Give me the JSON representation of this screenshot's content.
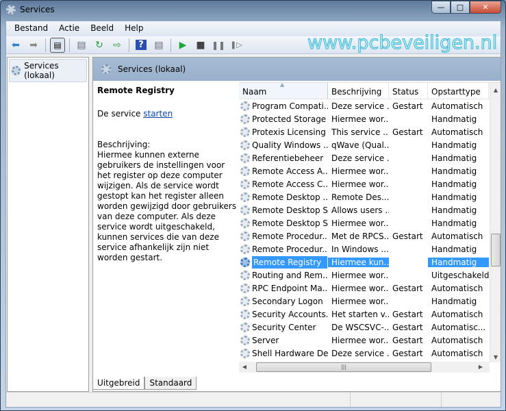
{
  "window": {
    "title": "Services",
    "controls": [
      "minimize",
      "maximize",
      "close"
    ]
  },
  "menu": [
    "Bestand",
    "Actie",
    "Beeld",
    "Help"
  ],
  "toolbar": {
    "icons": [
      "back-icon",
      "forward-icon",
      "show-hide-console-tree-icon",
      "properties-icon",
      "refresh-icon",
      "export-list-icon",
      "help-icon",
      "show-action-pane-icon",
      "start-service-icon",
      "stop-service-icon",
      "pause-service-icon",
      "restart-service-icon"
    ]
  },
  "watermark": "www.pcbeveiligen.nl",
  "tree": {
    "item": "Services (lokaal)"
  },
  "pane": {
    "title": "Services (lokaal)"
  },
  "details": {
    "service_name": "Remote Registry",
    "action_prefix": "De service ",
    "action_link": "starten",
    "description_label": "Beschrijving:",
    "description": "Hiermee kunnen externe gebruikers de instellingen voor het register op deze computer wijzigen. Als de service wordt gestopt kan het register alleen worden gewijzigd door gebruikers van deze computer. Als deze service wordt uitgeschakeld, kunnen services die van deze service afhankelijk zijn niet worden gestart."
  },
  "list": {
    "columns": [
      "Naam",
      "Beschrijving",
      "Status",
      "Opstarttype"
    ],
    "sorted_column": "Naam",
    "rows": [
      {
        "name": "Program Compati...",
        "desc": "Deze service ...",
        "status": "Gestart",
        "startup": "Automatisch"
      },
      {
        "name": "Protected Storage",
        "desc": "Hiermee wor...",
        "status": "",
        "startup": "Handmatig"
      },
      {
        "name": "Protexis Licensing ...",
        "desc": "This service ...",
        "status": "Gestart",
        "startup": "Automatisch"
      },
      {
        "name": "Quality Windows ...",
        "desc": "qWave (Qual...",
        "status": "",
        "startup": "Handmatig"
      },
      {
        "name": "Referentiebeheer",
        "desc": "Deze service ...",
        "status": "",
        "startup": "Handmatig"
      },
      {
        "name": "Remote Access A...",
        "desc": "Hiermee wor...",
        "status": "",
        "startup": "Handmatig"
      },
      {
        "name": "Remote Access C...",
        "desc": "Hiermee wor...",
        "status": "",
        "startup": "Handmatig"
      },
      {
        "name": "Remote Desktop ...",
        "desc": "Remote Des...",
        "status": "",
        "startup": "Handmatig"
      },
      {
        "name": "Remote Desktop S...",
        "desc": "Allows users ...",
        "status": "",
        "startup": "Handmatig"
      },
      {
        "name": "Remote Desktop S...",
        "desc": "Hiermee wor...",
        "status": "",
        "startup": "Handmatig"
      },
      {
        "name": "Remote Procedur...",
        "desc": "Met de RPCS...",
        "status": "Gestart",
        "startup": "Automatisch"
      },
      {
        "name": "Remote Procedur...",
        "desc": "In Windows ...",
        "status": "",
        "startup": "Handmatig"
      },
      {
        "name": "Remote Registry",
        "desc": "Hiermee kun...",
        "status": "",
        "startup": "Handmatig",
        "selected": true
      },
      {
        "name": "Routing and Rem...",
        "desc": "Hiermee wor...",
        "status": "",
        "startup": "Uitgeschakeld"
      },
      {
        "name": "RPC Endpoint Ma...",
        "desc": "Hiermee wor...",
        "status": "Gestart",
        "startup": "Automatisch"
      },
      {
        "name": "Secondary Logon",
        "desc": "Hiermee wor...",
        "status": "",
        "startup": "Handmatig"
      },
      {
        "name": "Security Accounts...",
        "desc": "Het starten v...",
        "status": "Gestart",
        "startup": "Automatisch"
      },
      {
        "name": "Security Center",
        "desc": "De WSCSVC-...",
        "status": "Gestart",
        "startup": "Automatisc..."
      },
      {
        "name": "Server",
        "desc": "Hiermee wor...",
        "status": "Gestart",
        "startup": "Automatisch"
      },
      {
        "name": "Shell Hardware De...",
        "desc": "Deze service ...",
        "status": "Gestart",
        "startup": "Automatisch"
      }
    ]
  },
  "tabs": [
    {
      "label": "Uitgebreid",
      "active": true
    },
    {
      "label": "Standaard",
      "active": false
    }
  ],
  "colors": {
    "selection": "#3399ff",
    "band": "#a7bcd4",
    "watermark": "#37b5d6"
  }
}
